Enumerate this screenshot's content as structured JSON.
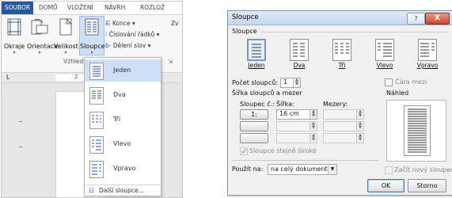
{
  "word": {
    "tabs": [
      "SOUBOR",
      "DOMŮ",
      "VLOŽENÍ",
      "NÁVRH",
      "ROZLOŽ"
    ],
    "ribbon_buttons": [
      {
        "label": "Okraje",
        "icon": "margins-icon"
      },
      {
        "label": "Orientace",
        "icon": "orientation-icon"
      },
      {
        "label": "Velikost",
        "icon": "page-size-icon"
      },
      {
        "label": "Sloupce",
        "icon": "columns-icon"
      }
    ],
    "small_items": [
      {
        "label": "Konce ▾",
        "icon": "breaks-icon"
      },
      {
        "label": "Číslování řádků ▾",
        "icon": "line-numbers-icon"
      },
      {
        "label": "Dělení slov ▾",
        "icon": "hyphenation-icon"
      }
    ],
    "partial_right": "Zv",
    "group_label": "Vzhled",
    "ruler_mark": "L",
    "ruler_number": "2",
    "column_menu": {
      "items": [
        "Jeden",
        "Dva",
        "Tři",
        "Vlevo",
        "Vpravo"
      ],
      "more": "Další sloupce..."
    }
  },
  "dialog": {
    "title": "Sloupce",
    "help_label": "?",
    "close_label": "X",
    "group_presets": "Sloupce",
    "presets": [
      "Jeden",
      "Dva",
      "Tři",
      "Vlevo",
      "Vpravo"
    ],
    "count_label": "Počet sloupců:",
    "count_value": "1",
    "line_between": "Čára mezi",
    "width_spacing_label": "Šířka sloupců a mezer",
    "preview_label": "Náhled",
    "col_header": "Sloupec č.:",
    "width_header": "Šířka:",
    "spacing_header": "Mezery:",
    "row1_col": "1:",
    "row1_width": "16 cm",
    "equal_width": "Sloupce stejně široké",
    "apply_to_label": "Použít na:",
    "apply_to_value": "na celý dokument",
    "new_column": "Začít nový sloupec",
    "ok": "OK",
    "cancel": "Storno"
  }
}
